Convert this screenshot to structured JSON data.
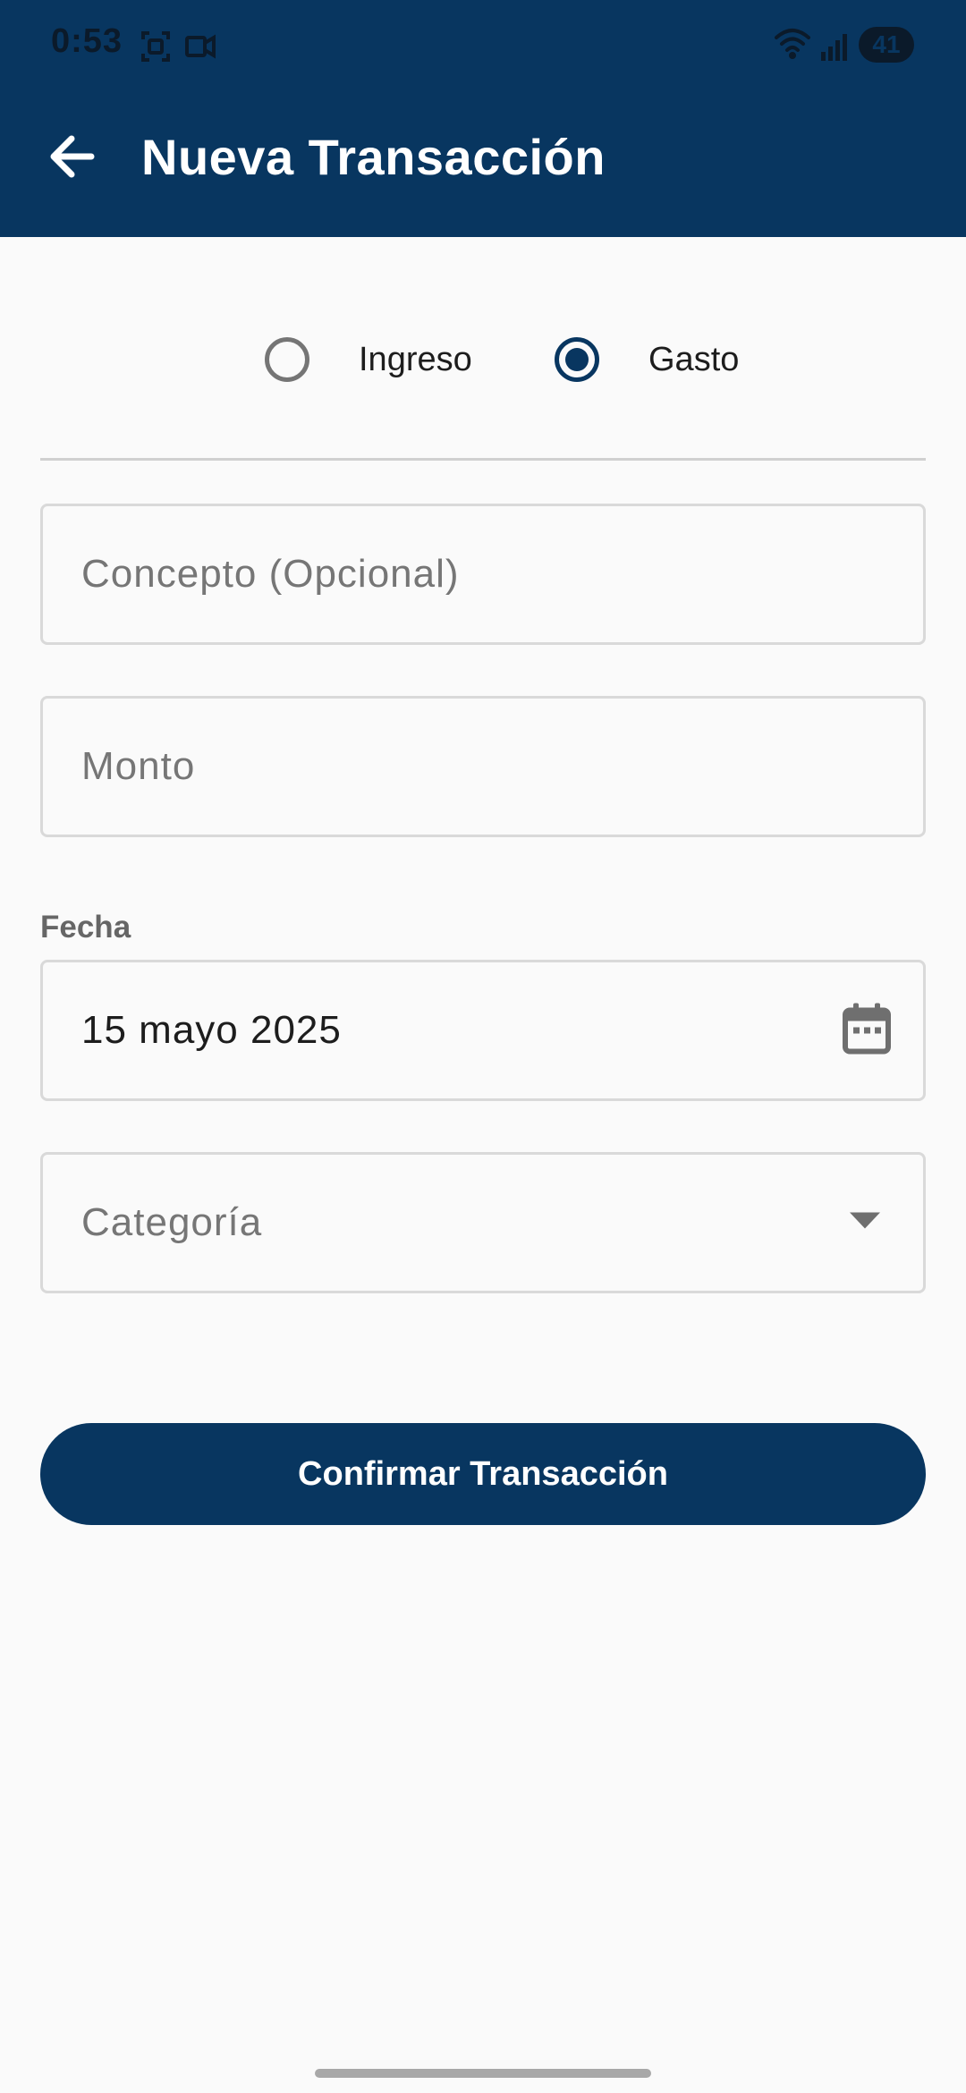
{
  "status_bar": {
    "time": "0:53",
    "battery": "41",
    "left_icons": [
      "screenshot-icon",
      "screen-record-icon"
    ],
    "right_icons": [
      "wifi-icon",
      "signal-icon",
      "battery-icon"
    ]
  },
  "app_bar": {
    "title": "Nueva Transacción",
    "back_icon": "arrow-left-icon",
    "background": "#083660"
  },
  "transaction_type": {
    "options": [
      {
        "label": "Ingreso",
        "selected": false
      },
      {
        "label": "Gasto",
        "selected": true
      }
    ]
  },
  "form": {
    "concept": {
      "placeholder": "Concepto (Opcional)",
      "value": ""
    },
    "amount": {
      "placeholder": "Monto",
      "value": ""
    },
    "date": {
      "label": "Fecha",
      "value": "15 mayo 2025",
      "icon": "calendar-icon"
    },
    "category": {
      "placeholder": "Categoría",
      "value": "",
      "icon": "dropdown-arrow-icon"
    }
  },
  "confirm_button": {
    "label": "Confirmar Transacción"
  },
  "colors": {
    "primary": "#083660",
    "background": "#fafafa",
    "field_border": "#d9d9d9",
    "placeholder": "#767676"
  }
}
